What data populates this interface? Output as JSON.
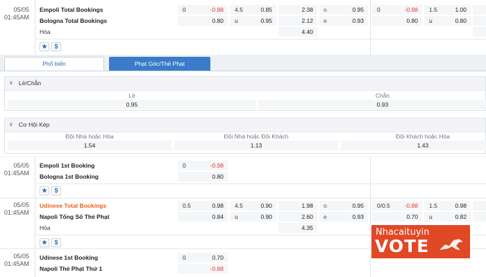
{
  "match1": {
    "date": "05/05",
    "time": "01:45AM",
    "home": "Empoli Total Bookings",
    "away": "Bologna Total Bookings",
    "draw": "Hòa",
    "hdp_line": "0",
    "hdp_home": "-0.98",
    "hdp_away": "0.80",
    "ou_line": "4.5",
    "ou_over": "0.85",
    "ou_under_label": "u",
    "ou_under": "0.95",
    "x12_home": "2.38",
    "x12_away": "2.12",
    "x12_draw": "4.40",
    "oe_o_label": "o",
    "oe_o": "0.95",
    "oe_e_label": "e",
    "oe_e": "0.93",
    "h1_hdp_line": "0",
    "h1_hdp_home": "-0.98",
    "h1_hdp_away": "0.80",
    "h1_ou_line": "1.5",
    "h1_ou_over": "1.00",
    "h1_ou_under_label": "u",
    "h1_ou_under": "0.80"
  },
  "icons": {
    "star": "★",
    "dollar": "$"
  },
  "tabs": {
    "popular": "Phổ biến",
    "corners": "Phạt Góc/Thẻ Phạt"
  },
  "odd_even": {
    "title": "Lẻ/Chẵn",
    "odd_label": "Lẻ",
    "odd_value": "0.95",
    "even_label": "Chẵn",
    "even_value": "0.93"
  },
  "double_chance": {
    "title": "Cơ Hội Kép",
    "opt1_label": "Đội Nhà hoặc Hòa",
    "opt1_value": "1.54",
    "opt2_label": "Đội Nhà hoặc Đội Khách",
    "opt2_value": "1.13",
    "opt3_label": "Đội Khách hoặc Hòa",
    "opt3_value": "1.43"
  },
  "match2": {
    "date": "05/05",
    "time": "01:45AM",
    "home": "Empoli 1st Booking",
    "away": "Bologna 1st Booking",
    "hdp_line": "0",
    "hdp_home": "-0.98",
    "hdp_away": "0.80"
  },
  "match3": {
    "date": "05/05",
    "time": "01:45AM",
    "home": "Udinese Total Bookings",
    "away": "Napoli Tổng Số Thẻ Phạt",
    "draw": "Hòa",
    "hdp_line": "0.5",
    "hdp_home": "0.98",
    "hdp_away": "0.84",
    "ou_line": "4.5",
    "ou_over": "0.90",
    "ou_under_label": "u",
    "ou_under": "0.90",
    "x12_home": "1.98",
    "x12_away": "2.60",
    "x12_draw": "4.35",
    "oe_o_label": "o",
    "oe_o": "0.95",
    "oe_e_label": "e",
    "oe_e": "0.93",
    "h1_hdp_line": "0/0.5",
    "h1_hdp_home": "-0.88",
    "h1_hdp_away": "0.70",
    "h1_ou_line": "1.5",
    "h1_ou_over": "0.98",
    "h1_ou_under_label": "u",
    "h1_ou_under": "0.82"
  },
  "match4": {
    "date": "05/05",
    "time": "01:45AM",
    "home": "Udinese 1st Booking",
    "away": "Napoli Thẻ Phạt Thứ 1",
    "hdp_line": "0",
    "hdp_home": "0.70",
    "hdp_away": "-0.88"
  },
  "watermark": {
    "line1": "Nhacaituyin",
    "line2": "VOTE"
  },
  "colors": {
    "accent": "#3a7cc9",
    "negative": "#e53935",
    "highlight": "#e8601c",
    "watermark": "#e04826"
  }
}
